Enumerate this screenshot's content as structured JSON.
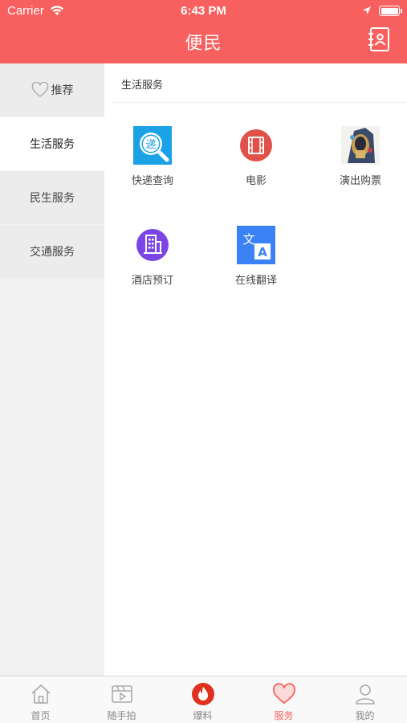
{
  "status_bar": {
    "carrier": "Carrier",
    "time": "6:43 PM"
  },
  "nav": {
    "title": "便民",
    "action_icon": "contacts-book-icon"
  },
  "sidebar": {
    "items": [
      {
        "label": "推荐",
        "icon": "heart-outline-icon",
        "active": false
      },
      {
        "label": "生活服务",
        "active": true
      },
      {
        "label": "民生服务",
        "active": false
      },
      {
        "label": "交通服务",
        "active": false
      }
    ]
  },
  "content": {
    "section_title": "生活服务",
    "services": [
      {
        "label": "快递查询",
        "icon": "express-delivery-icon"
      },
      {
        "label": "电影",
        "icon": "film-icon"
      },
      {
        "label": "演出购票",
        "icon": "performance-ticket-icon"
      },
      {
        "label": "酒店预订",
        "icon": "hotel-icon"
      },
      {
        "label": "在线翻译",
        "icon": "translate-icon"
      }
    ]
  },
  "tabbar": {
    "tabs": [
      {
        "label": "首页",
        "icon": "home-icon",
        "active": false
      },
      {
        "label": "随手拍",
        "icon": "video-clip-icon",
        "active": false
      },
      {
        "label": "爆料",
        "icon": "fire-icon",
        "active": false
      },
      {
        "label": "服务",
        "icon": "heart-icon",
        "active": true
      },
      {
        "label": "我的",
        "icon": "user-icon",
        "active": false
      }
    ]
  },
  "colors": {
    "accent": "#f7605e",
    "sidebar_bg": "#f1f1f1",
    "express_blue": "#1aa1e6",
    "film_red": "#e0514a",
    "hotel_purple": "#7b45e6",
    "translate_blue": "#3b82f6",
    "fire_red": "#e0301e"
  }
}
